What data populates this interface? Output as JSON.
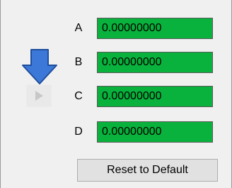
{
  "fields": [
    {
      "label": "A",
      "value": "0.00000000"
    },
    {
      "label": "B",
      "value": "0.00000000"
    },
    {
      "label": "C",
      "value": "0.00000000"
    },
    {
      "label": "D",
      "value": "0.00000000"
    }
  ],
  "icons": {
    "down_arrow": "down-arrow-icon",
    "play": "play-icon"
  },
  "colors": {
    "field_background": "#08b23c",
    "arrow_fill": "#3b78d8",
    "arrow_stroke": "#1f4e9c",
    "play_disabled": "#c8c8c8"
  },
  "reset_button": {
    "label": "Reset to Default"
  }
}
